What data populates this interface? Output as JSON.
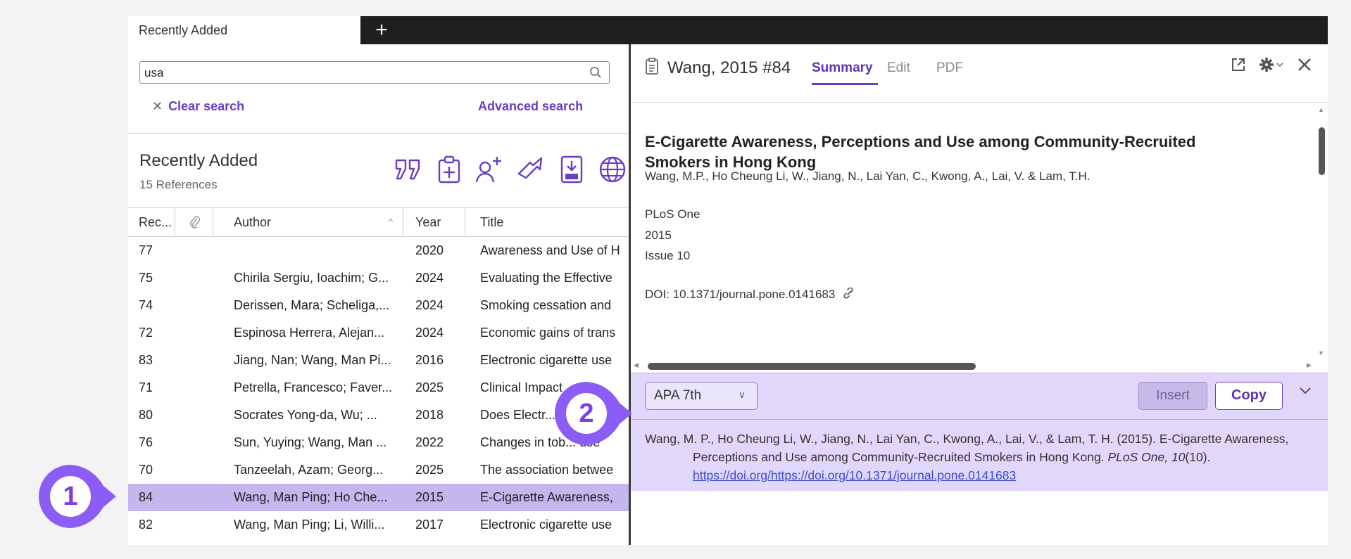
{
  "tab": {
    "label": "Recently Added",
    "add": "+"
  },
  "search": {
    "value": "usa",
    "clear_label": "Clear search",
    "advanced_label": "Advanced search"
  },
  "group": {
    "title": "Recently Added",
    "count": "15 References"
  },
  "table": {
    "headers": {
      "rec": "Rec...",
      "author": "Author",
      "year": "Year",
      "title": "Title"
    },
    "rows": [
      {
        "rec": "77",
        "author": "",
        "year": "2020",
        "title": "Awareness and Use of H"
      },
      {
        "rec": "75",
        "author": "Chirila Sergiu, Ioachim; G...",
        "year": "2024",
        "title": "Evaluating the Effective"
      },
      {
        "rec": "74",
        "author": "Derissen, Mara; Scheliga,...",
        "year": "2024",
        "title": "Smoking cessation and"
      },
      {
        "rec": "72",
        "author": "Espinosa Herrera, Alejan...",
        "year": "2024",
        "title": "Economic gains of trans"
      },
      {
        "rec": "83",
        "author": "Jiang, Nan; Wang, Man Pi...",
        "year": "2016",
        "title": "Electronic cigarette use"
      },
      {
        "rec": "71",
        "author": "Petrella, Francesco; Faver...",
        "year": "2025",
        "title": "Clinical Impact ... in"
      },
      {
        "rec": "80",
        "author": "Socrates Yong-da, Wu; ...",
        "year": "2018",
        "title": "Does Electr..."
      },
      {
        "rec": "76",
        "author": "Sun, Yuying; Wang, Man ...",
        "year": "2022",
        "title": "Changes in tob... use"
      },
      {
        "rec": "70",
        "author": "Tanzeelah, Azam; Georg...",
        "year": "2025",
        "title": "The association betwee"
      },
      {
        "rec": "84",
        "author": "Wang, Man Ping; Ho Che...",
        "year": "2015",
        "title": "E-Cigarette Awareness,",
        "selected": true
      },
      {
        "rec": "82",
        "author": "Wang, Man Ping; Li, Willi...",
        "year": "2017",
        "title": "Electronic cigarette use"
      }
    ]
  },
  "detail": {
    "ref_label": "Wang, 2015 #84",
    "tabs": [
      "Summary",
      "Edit",
      "PDF"
    ],
    "title": "E-Cigarette Awareness, Perceptions and Use among Community-Recruited Smokers in Hong Kong",
    "authors": "Wang, M.P., Ho Cheung Li, W., Jiang, N., Lai Yan, C., Kwong, A., Lai, V. & Lam, T.H.",
    "journal": "PLoS One",
    "year": "2015",
    "issue": "Issue 10",
    "doi": "DOI: 10.1371/journal.pone.0141683"
  },
  "citation": {
    "style": "APA 7th",
    "insert_label": "Insert",
    "copy_label": "Copy",
    "text_main": "Wang, M. P., Ho Cheung Li, W., Jiang, N., Lai Yan, C., Kwong, A., Lai, V., & Lam, T. H. (2015). E-Cigarette Awareness, Perceptions and Use among Community-Recruited Smokers in Hong Kong. ",
    "journal": "PLoS One",
    "sep": ", ",
    "volume": "10",
    "issue_part": "(10). ",
    "link": "https://doi.org/https://doi.org/10.1371/journal.pone.0141683"
  },
  "callouts": {
    "one": "1",
    "two": "2"
  },
  "colors": {
    "accent": "#6a3dc6",
    "callout": "#8b5cf6",
    "selected_row": "#c5b6ee",
    "citation_bg": "#e1d7fb"
  }
}
